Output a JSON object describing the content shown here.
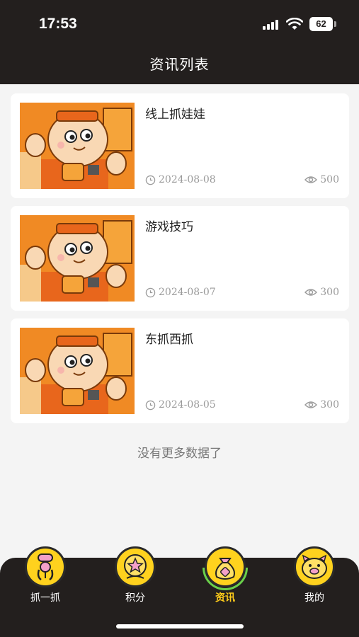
{
  "status": {
    "time": "17:53",
    "battery": "62"
  },
  "header": {
    "title": "资讯列表"
  },
  "articles": [
    {
      "title": "线上抓娃娃",
      "date": "2024-08-08",
      "views": "500"
    },
    {
      "title": "游戏技巧",
      "date": "2024-08-07",
      "views": "300"
    },
    {
      "title": "东抓西抓",
      "date": "2024-08-05",
      "views": "300"
    }
  ],
  "footer_note": "没有更多数据了",
  "tabs": [
    {
      "label": "抓一抓",
      "icon": "claw-machine-icon"
    },
    {
      "label": "积分",
      "icon": "star-points-icon"
    },
    {
      "label": "资讯",
      "icon": "money-bag-icon",
      "active": true
    },
    {
      "label": "我的",
      "icon": "pig-face-icon"
    }
  ],
  "colors": {
    "accent": "#ffd21e",
    "header_bg": "#231f1e",
    "active_label": "#ffcc1a"
  }
}
